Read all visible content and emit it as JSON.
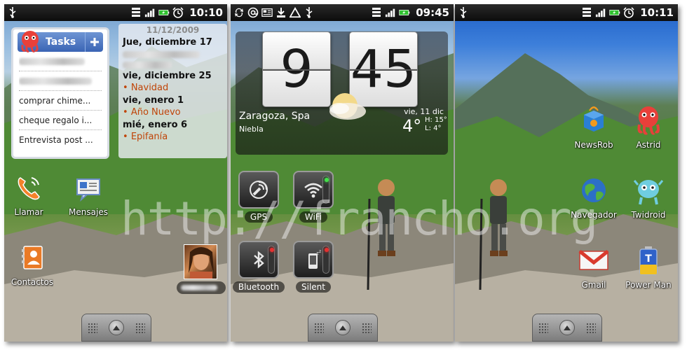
{
  "colors": {
    "tasks_header": "#3a64b4",
    "calendar_event": "#c04408",
    "led_green": "#43e04a",
    "led_red": "#e53030",
    "statusbar": "#111111"
  },
  "screens": [
    {
      "status_time": "10:10",
      "tasks_widget": {
        "title": "Tasks",
        "items": [
          "comprar chime...",
          "cheque regalo i...",
          "Entrevista post ..."
        ]
      },
      "calendar_widget": {
        "date": "11/12/2009",
        "day1": "Jue, diciembre 17",
        "day2": "vie, diciembre 25",
        "event2": "Navidad",
        "day3": "vie, enero 1",
        "event3": "Año Nuevo",
        "day4": "mié, enero 6",
        "event4": "Epifanía"
      },
      "apps": {
        "call": "Llamar",
        "messages": "Mensajes",
        "contacts": "Contactos"
      }
    },
    {
      "status_time": "09:45",
      "clock_widget": {
        "hour": "9",
        "minute": "45",
        "city": "Zaragoza, Spa",
        "condition": "Niebla",
        "date": "vie, 11 dic",
        "temp": "4°",
        "high": "15°",
        "low": "4°",
        "high_label": "H:",
        "low_label": "L:"
      },
      "toggles": {
        "gps": "GPS",
        "wifi": "WiFi",
        "bluetooth": "Bluetooth",
        "silent": "Silent"
      }
    },
    {
      "status_time": "10:11",
      "apps": {
        "newsrob": "NewsRob",
        "astrid": "Astrid",
        "browser": "Navegador",
        "twidroid": "Twidroid",
        "gmail": "Gmail",
        "powermanager": "Power Man"
      }
    }
  ],
  "watermark": "http://francho.org"
}
